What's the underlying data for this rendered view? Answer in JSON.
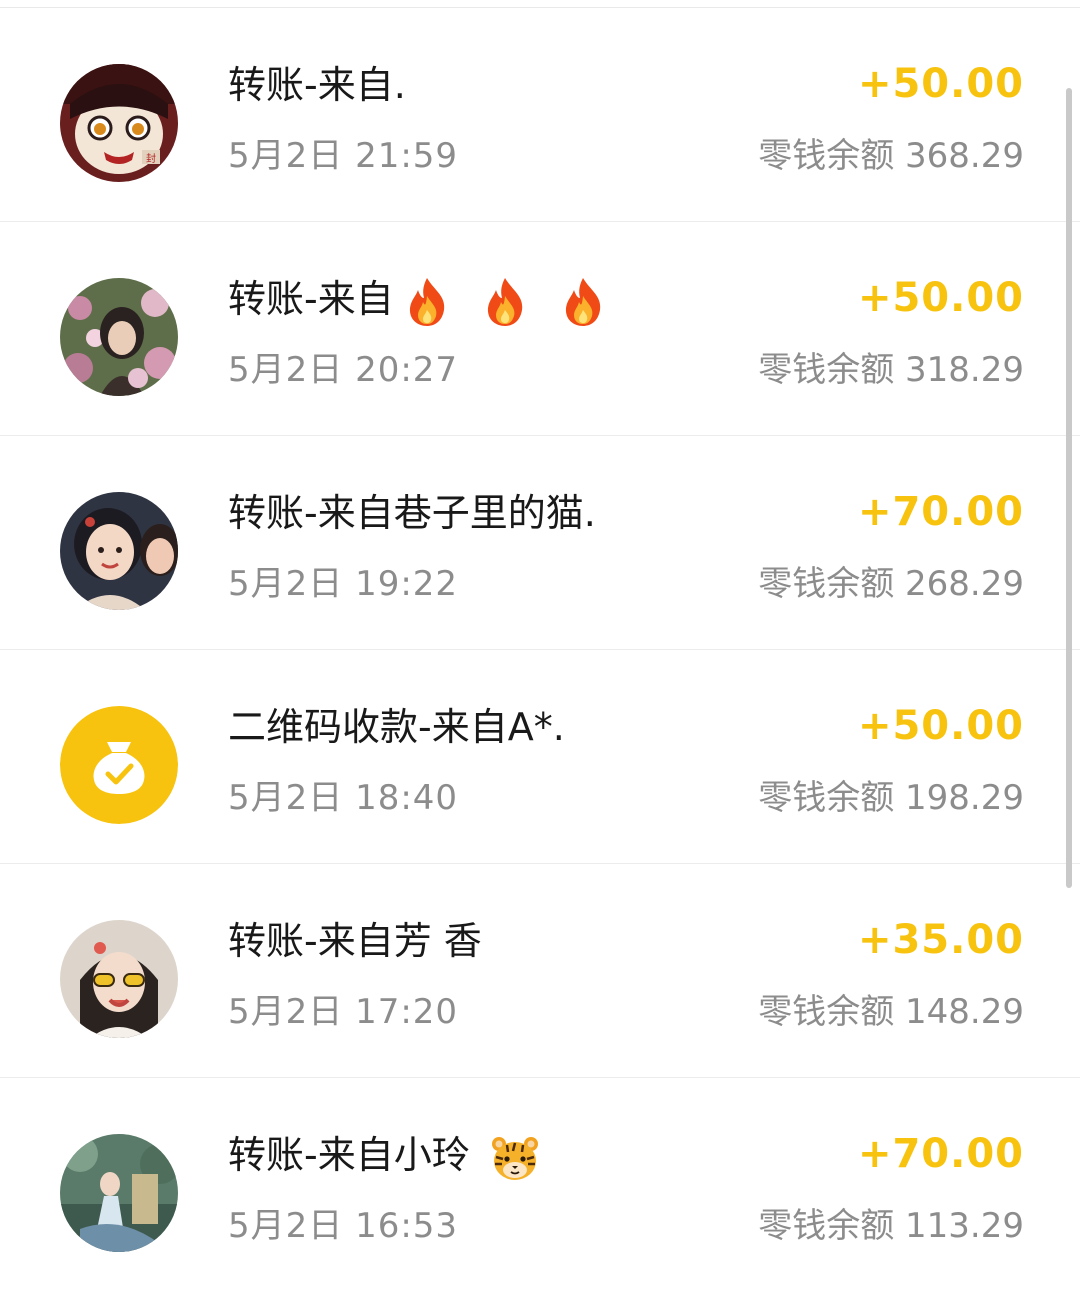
{
  "accent_color": "#f7c30f",
  "transactions": [
    {
      "title": "转账-来自.",
      "date": "5月2日 21:59",
      "amount": "+50.00",
      "balance": "零钱余额 368.29",
      "avatar": "anime-character-photo",
      "emojis": []
    },
    {
      "title": "转账-来自",
      "date": "5月2日 20:27",
      "amount": "+50.00",
      "balance": "零钱余额 318.29",
      "avatar": "girl-in-flowers-photo",
      "emojis": [
        "fire-emoji",
        "fire-emoji",
        "fire-emoji"
      ]
    },
    {
      "title": "转账-来自巷子里的猫.",
      "date": "5月2日 19:22",
      "amount": "+70.00",
      "balance": "零钱余额 268.29",
      "avatar": "illustrated-girls-photo",
      "emojis": []
    },
    {
      "title": "二维码收款-来自A*.",
      "date": "5月2日 18:40",
      "amount": "+50.00",
      "balance": "零钱余额 198.29",
      "avatar": "money-bag-check-icon",
      "emojis": []
    },
    {
      "title": "转账-来自芳 香",
      "date": "5月2日 17:20",
      "amount": "+35.00",
      "balance": "零钱余额 148.29",
      "avatar": "child-with-sunglasses-photo",
      "emojis": []
    },
    {
      "title": "转账-来自小玲",
      "date": "5月2日 16:53",
      "amount": "+70.00",
      "balance": "零钱余额 113.29",
      "avatar": "outdoor-person-photo",
      "emojis": [
        "tiger-face-emoji"
      ]
    }
  ]
}
